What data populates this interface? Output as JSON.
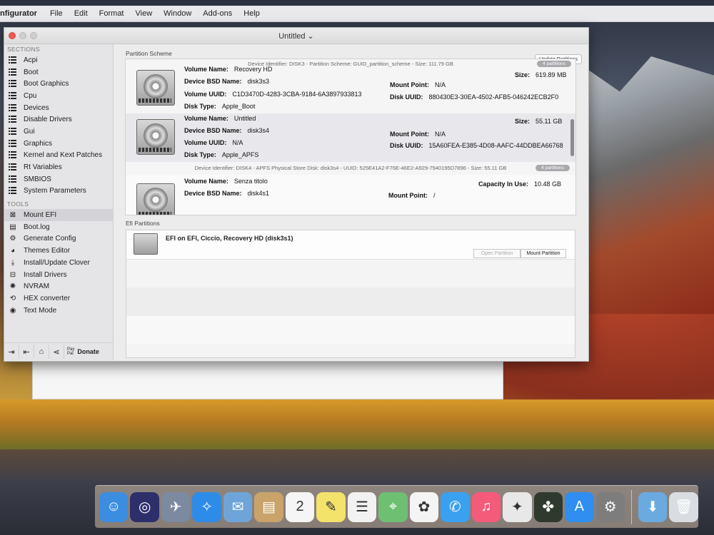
{
  "menubar": {
    "app": "nfigurator",
    "items": [
      "File",
      "Edit",
      "Format",
      "View",
      "Window",
      "Add-ons",
      "Help"
    ]
  },
  "window": {
    "title": "Untitled ⌄"
  },
  "sidebar": {
    "sections_header": "SECTIONS",
    "sections": [
      "Acpi",
      "Boot",
      "Boot Graphics",
      "Cpu",
      "Devices",
      "Disable Drivers",
      "Gui",
      "Graphics",
      "Kernel and Kext Patches",
      "Rt Variables",
      "SMBIOS",
      "System Parameters"
    ],
    "tools_header": "TOOLS",
    "tools": [
      {
        "label": "Mount EFI",
        "icon": "mount-efi-icon",
        "glyph": "⊠"
      },
      {
        "label": "Boot.log",
        "icon": "boot-log-icon",
        "glyph": "▤"
      },
      {
        "label": "Generate Config",
        "icon": "generate-config-icon",
        "glyph": "⚙"
      },
      {
        "label": "Themes Editor",
        "icon": "themes-editor-icon",
        "glyph": "◕"
      },
      {
        "label": "Install/Update Clover",
        "icon": "install-clover-icon",
        "glyph": "⤓"
      },
      {
        "label": "Install Drivers",
        "icon": "install-drivers-icon",
        "glyph": "⊟"
      },
      {
        "label": "NVRAM",
        "icon": "nvram-icon",
        "glyph": "✺"
      },
      {
        "label": "HEX converter",
        "icon": "hex-converter-icon",
        "glyph": "⟲"
      },
      {
        "label": "Text Mode",
        "icon": "text-mode-icon",
        "glyph": "◉"
      }
    ],
    "bottom": {
      "pay_line1": "Pay",
      "pay_line2": "Pal",
      "donate": "Donate"
    }
  },
  "partition_scheme": {
    "header": "Partition Scheme",
    "update_button": "Update Partitions",
    "disk3_line": "Device Identifier: DISK3 - Partition Scheme: GUID_partition_scheme - Size: 111.79 GB",
    "disk3_count": "4 partitions",
    "disk4_line": "Device Identifier: DISK4 - APFS Physical Store Disk: disk3s4 - UUID: 525E41A2-F76E-46E2-A929-7940195D7896 - Size: 55.11 GB",
    "disk4_count": "4 partitions",
    "labels": {
      "volume_name": "Volume Name:",
      "bsd_name": "Device BSD Name:",
      "volume_uuid": "Volume UUID:",
      "disk_type": "Disk Type:",
      "size": "Size:",
      "mount_point": "Mount Point:",
      "disk_uuid": "Disk UUID:",
      "capacity": "Capacity In Use:"
    },
    "partitions": [
      {
        "volume_name": "Recovery HD",
        "bsd_name": "disk3s3",
        "volume_uuid": "C1D3470D-4283-3CBA-9184-6A3897933813",
        "disk_type": "Apple_Boot",
        "size": "619.89 MB",
        "mount_point": "N/A",
        "disk_uuid": "880430E3-30EA-4502-AFB5-046242ECB2F0"
      },
      {
        "volume_name": "Untitled",
        "bsd_name": "disk3s4",
        "volume_uuid": "N/A",
        "disk_type": "Apple_APFS",
        "size": "55.11 GB",
        "mount_point": "N/A",
        "disk_uuid": "15A60FEA-E385-4D08-AAFC-44DDBEA66768"
      },
      {
        "volume_name": "Senza titolo",
        "bsd_name": "disk4s1",
        "capacity": "10.48 GB",
        "mount_point": "/"
      }
    ]
  },
  "efi": {
    "header": "Efi Partitions",
    "entry": "EFI on EFI, Ciccio, Recovery HD (disk3s1)",
    "open_button": "Open Partition",
    "mount_button": "Mount Partition"
  },
  "dock": {
    "apps": [
      {
        "name": "finder-icon",
        "glyph": "☺",
        "color": "#3b8de0"
      },
      {
        "name": "siri-icon",
        "glyph": "◎",
        "color": "#2c2f6a"
      },
      {
        "name": "launchpad-icon",
        "glyph": "✈",
        "color": "#7c8aa0"
      },
      {
        "name": "safari-icon",
        "glyph": "✧",
        "color": "#2d8ce8"
      },
      {
        "name": "mail-icon",
        "glyph": "✉",
        "color": "#6fa4d8"
      },
      {
        "name": "notes-folder-icon",
        "glyph": "▤",
        "color": "#c9a36a"
      },
      {
        "name": "calendar-icon",
        "glyph": "2",
        "color": "#f5f5f5"
      },
      {
        "name": "notes-icon",
        "glyph": "✎",
        "color": "#f3e36a"
      },
      {
        "name": "reminders-icon",
        "glyph": "☰",
        "color": "#f2f2f2"
      },
      {
        "name": "maps-icon",
        "glyph": "⌖",
        "color": "#6fbf73"
      },
      {
        "name": "photos-icon",
        "glyph": "✿",
        "color": "#f4f4f4"
      },
      {
        "name": "messages-icon",
        "glyph": "✆",
        "color": "#3aa0f0"
      },
      {
        "name": "music-icon",
        "glyph": "♫",
        "color": "#f45a7a"
      },
      {
        "name": "clover-icon",
        "glyph": "✦",
        "color": "#e8e8e8"
      },
      {
        "name": "classic-icon",
        "glyph": "✤",
        "color": "#2f3a2f"
      },
      {
        "name": "app-store-icon",
        "glyph": "A",
        "color": "#2f8ef0"
      },
      {
        "name": "system-preferences-icon",
        "glyph": "⚙",
        "color": "#7d7d7d"
      }
    ],
    "trailing": [
      {
        "name": "downloads-icon",
        "glyph": "⬇",
        "color": "#6aaae0"
      },
      {
        "name": "trash-icon",
        "glyph": "🗑",
        "color": "#d9dde2"
      }
    ]
  }
}
